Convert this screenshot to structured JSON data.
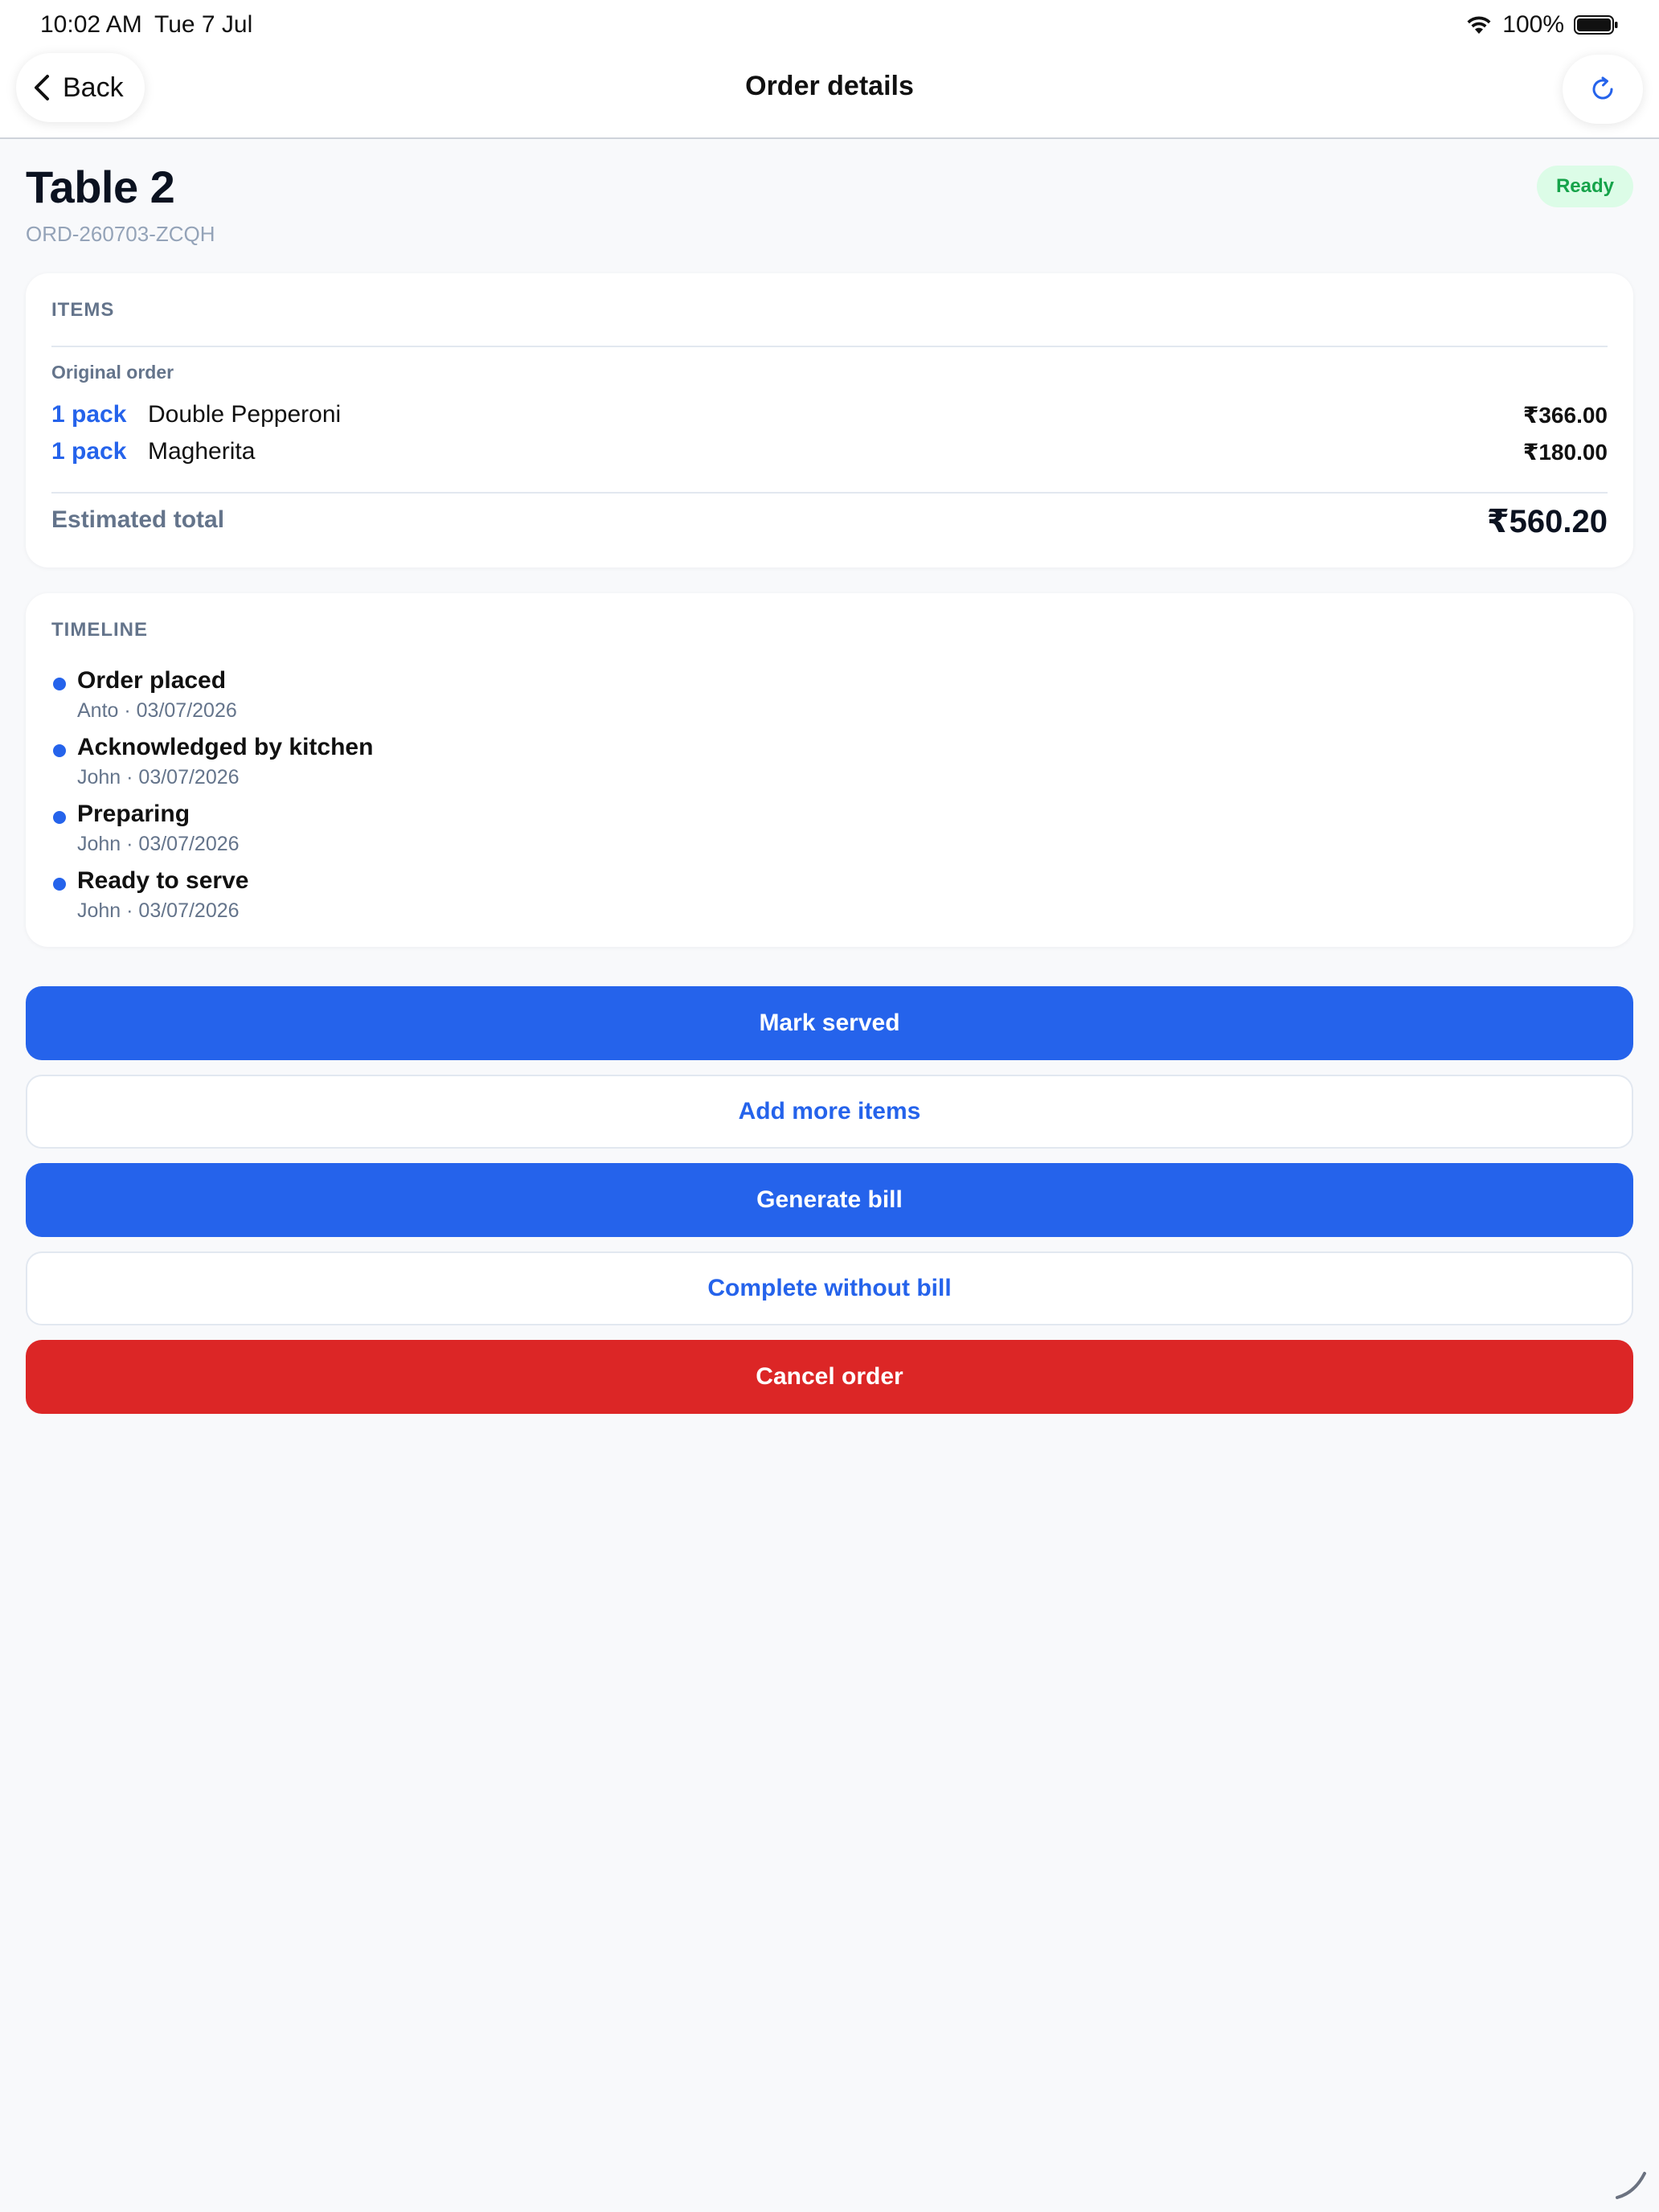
{
  "status_bar": {
    "time": "10:02 AM",
    "date": "Tue 7 Jul",
    "battery": "100%",
    "icons": [
      "wifi-icon",
      "battery-icon"
    ]
  },
  "nav": {
    "back_label": "Back",
    "title": "Order details",
    "back_icon": "chevron-left-icon",
    "refresh_icon": "refresh-icon"
  },
  "order": {
    "table": "Table 2",
    "id": "ORD-260703-ZCQH",
    "status": "Ready"
  },
  "items_section": {
    "heading": "ITEMS",
    "group_label": "Original order",
    "items": [
      {
        "qty": "1 pack",
        "name": "Double Pepperoni",
        "price": "₹366.00"
      },
      {
        "qty": "1 pack",
        "name": "Magherita",
        "price": "₹180.00"
      }
    ],
    "total_label": "Estimated total",
    "total_value": "₹560.20"
  },
  "timeline": {
    "heading": "TIMELINE",
    "events": [
      {
        "title": "Order placed",
        "meta": "Anto · 03/07/2026"
      },
      {
        "title": "Acknowledged by kitchen",
        "meta": "John · 03/07/2026"
      },
      {
        "title": "Preparing",
        "meta": "John · 03/07/2026"
      },
      {
        "title": "Ready to serve",
        "meta": "John · 03/07/2026"
      }
    ]
  },
  "actions": {
    "mark_served": "Mark served",
    "add_more_items": "Add more items",
    "generate_bill": "Generate bill",
    "complete_without_bill": "Complete without bill",
    "cancel_order": "Cancel order"
  },
  "colors": {
    "accent": "#2563eb",
    "danger": "#dc2626",
    "success_text": "#16a34a",
    "success_bg": "#dcfce7",
    "page_bg": "#f8f9fb"
  }
}
